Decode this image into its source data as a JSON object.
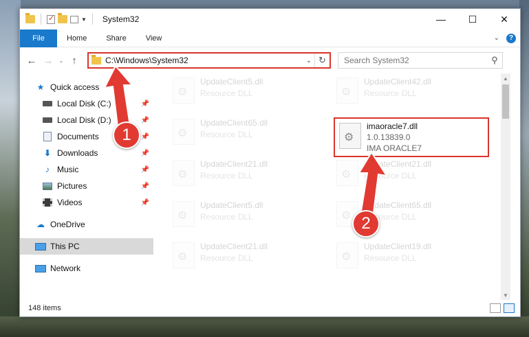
{
  "window": {
    "title": "System32"
  },
  "ribbon": {
    "tabs": [
      "File",
      "Home",
      "Share",
      "View"
    ],
    "help": "?"
  },
  "address": {
    "path": "C:\\Windows\\System32"
  },
  "search": {
    "placeholder": "Search System32"
  },
  "nav_pane": {
    "quick_access": "Quick access",
    "items": [
      {
        "label": "Local Disk (C:)",
        "icon": "drive-icon"
      },
      {
        "label": "Local Disk (D:)",
        "icon": "drive-icon"
      },
      {
        "label": "Documents",
        "icon": "documents-icon"
      },
      {
        "label": "Downloads",
        "icon": "downloads-icon"
      },
      {
        "label": "Music",
        "icon": "music-icon"
      },
      {
        "label": "Pictures",
        "icon": "pictures-icon"
      },
      {
        "label": "Videos",
        "icon": "videos-icon"
      }
    ],
    "onedrive": "OneDrive",
    "this_pc": "This PC",
    "network": "Network"
  },
  "files": [
    {
      "name": "UpdateClient5.dll",
      "type": "Resource DLL"
    },
    {
      "name": "UpdateClient42.dll",
      "type": "Resource DLL"
    },
    {
      "name": "UpdateClient65.dll",
      "type": "Resource DLL"
    },
    {
      "name": "imaoracle7.dll",
      "version": "1.0.13839.0",
      "desc": "IMA ORACLE7"
    },
    {
      "name": "UpdateClient21.dll",
      "type": "Resource DLL"
    },
    {
      "name": "UpdateClient21.dll",
      "type": "Resource DLL"
    },
    {
      "name": "UpdateClient5.dll",
      "type": "Resource DLL"
    },
    {
      "name": "UpdateClient65.dll",
      "type": "Resource DLL"
    },
    {
      "name": "UpdateClient21.dll",
      "type": "Resource DLL"
    },
    {
      "name": "UpdateClient19.dll",
      "type": "Resource DLL"
    }
  ],
  "status": {
    "item_count": "148 items"
  },
  "annotations": {
    "step1": "1",
    "step2": "2"
  }
}
